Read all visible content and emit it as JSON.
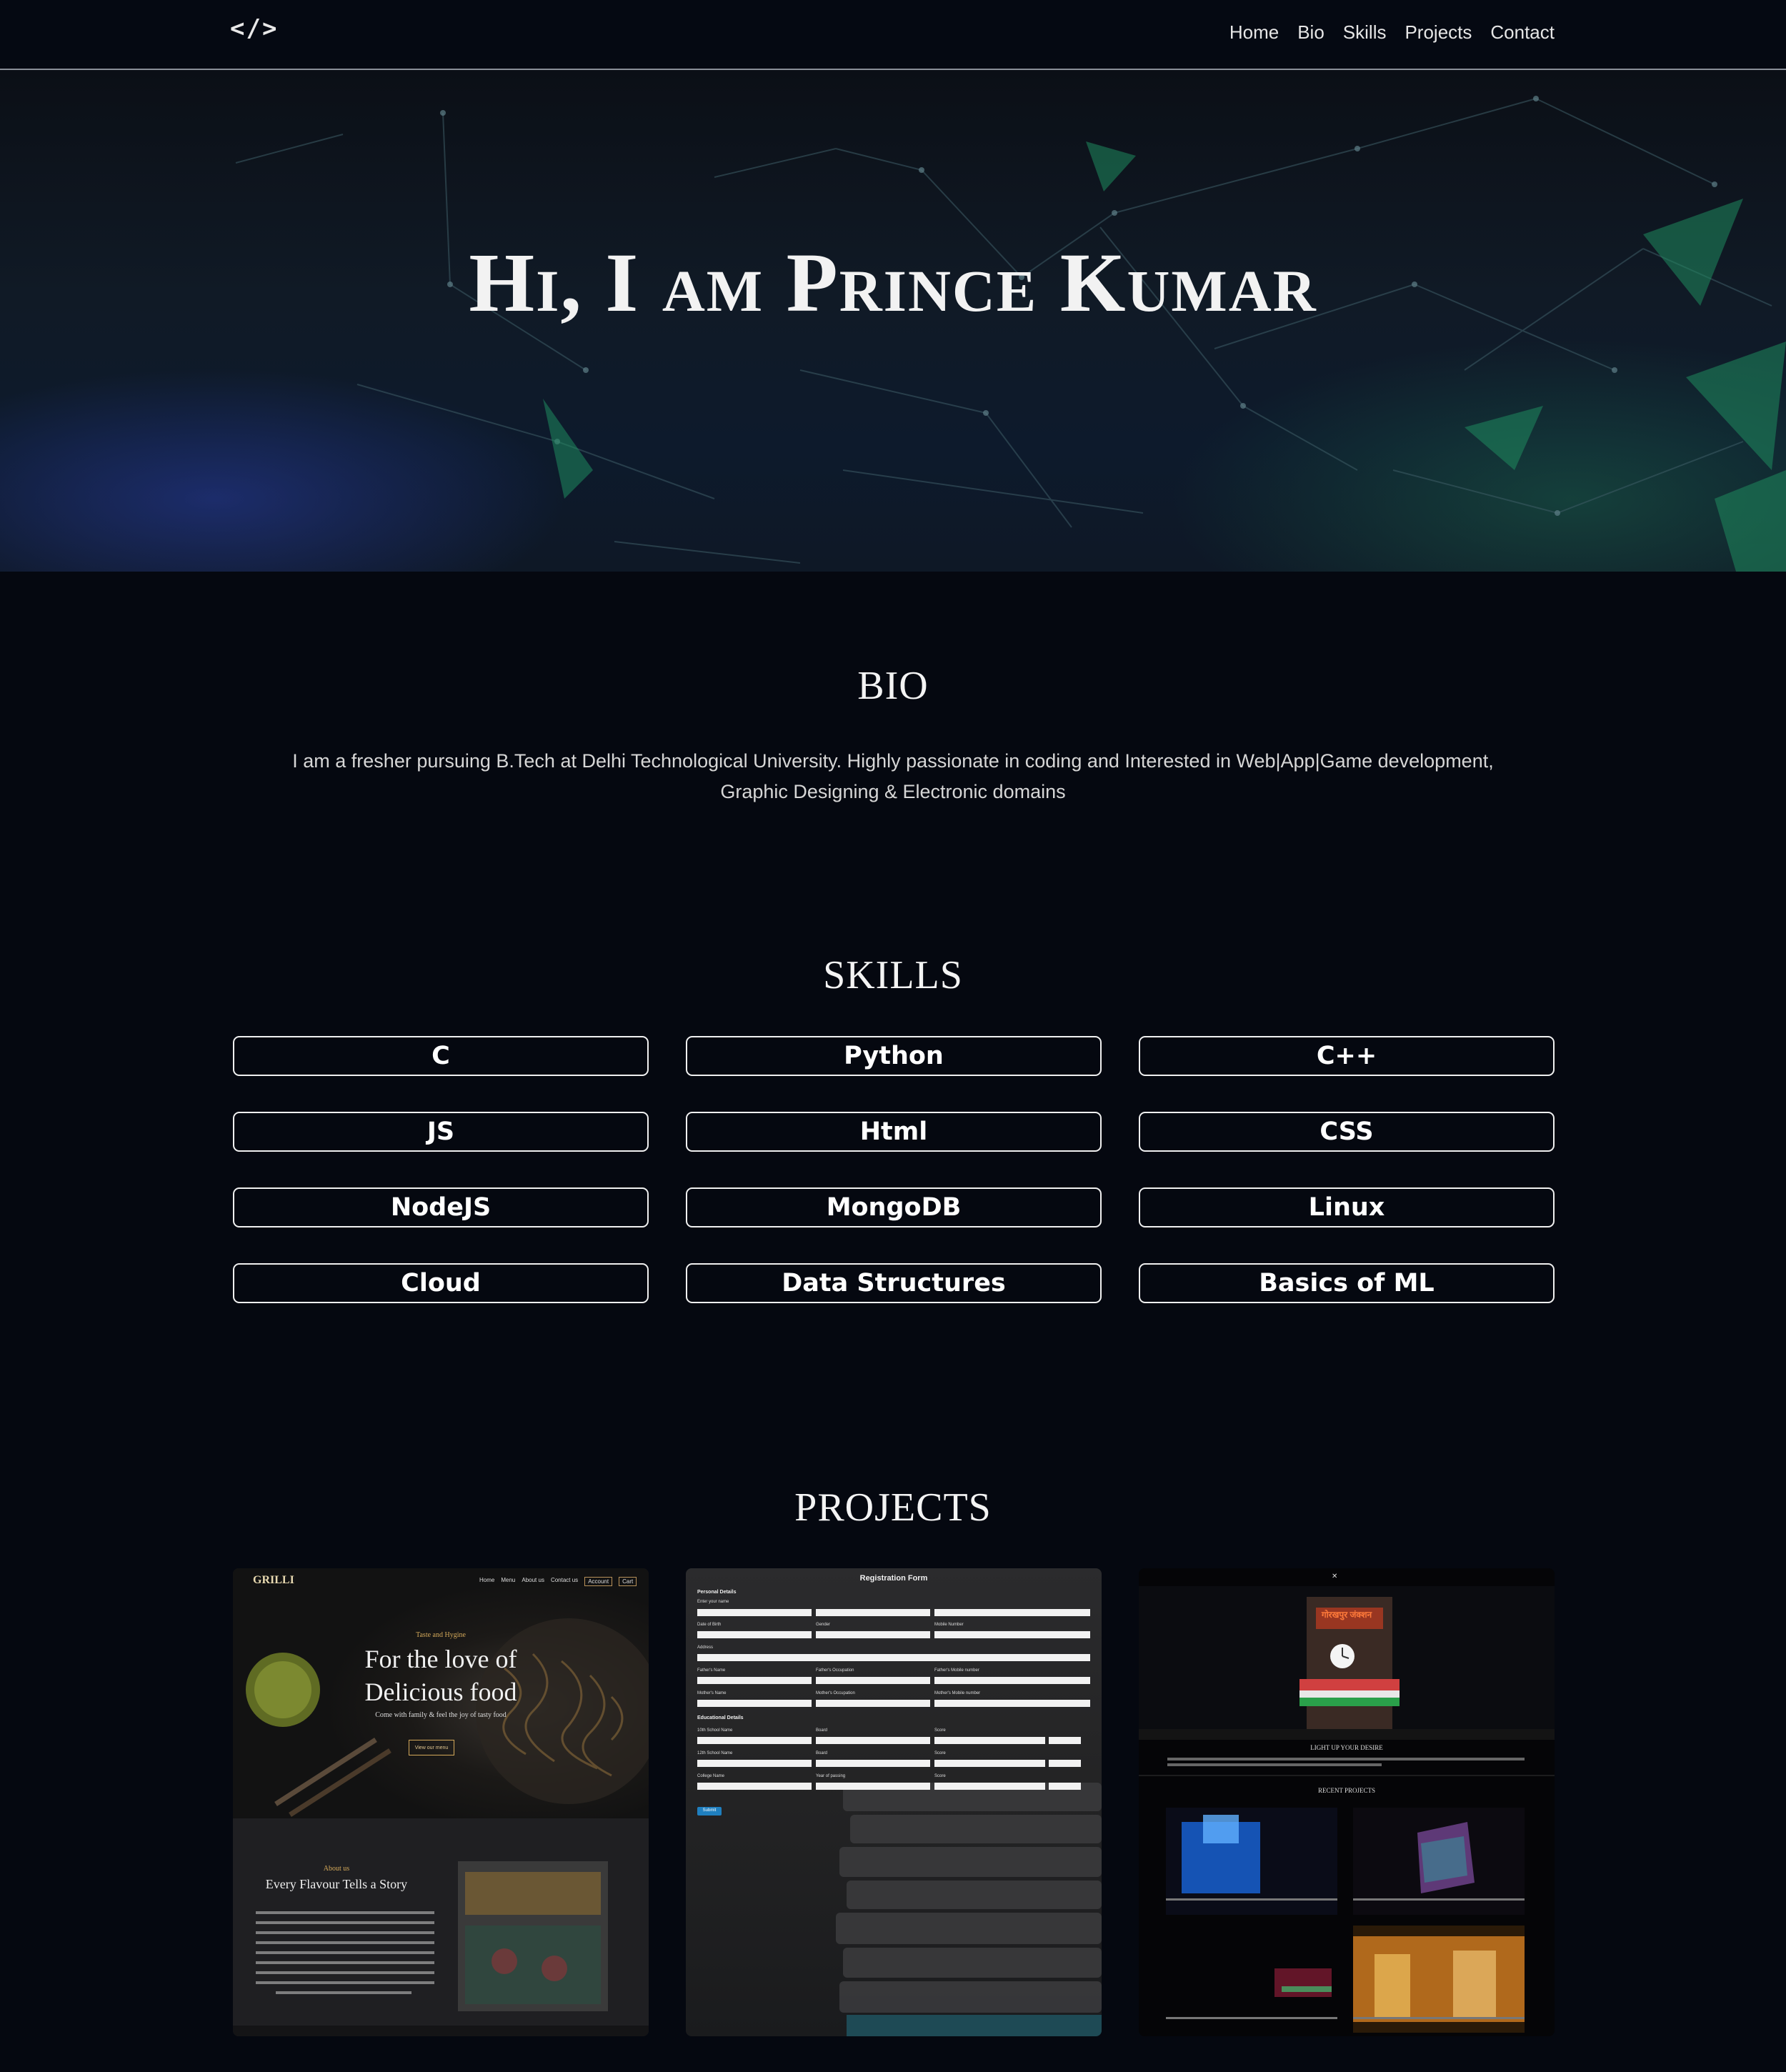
{
  "nav": {
    "logo": "</>",
    "links": [
      "Home",
      "Bio",
      "Skills",
      "Projects",
      "Contact"
    ]
  },
  "hero": {
    "title": "Hi, I am Prince Kumar"
  },
  "bio": {
    "heading": "BIO",
    "line1": "I am a fresher pursuing B.Tech at Delhi Technological University. Highly passionate in coding and Interested in Web|App|Game development,",
    "line2": "Graphic Designing & Electronic domains"
  },
  "skills": {
    "heading": "SKILLS",
    "items": [
      "C",
      "Python",
      "C++",
      "JS",
      "Html",
      "CSS",
      "NodeJS",
      "MongoDB",
      "Linux",
      "Cloud",
      "Data Structures",
      "Basics of ML"
    ]
  },
  "projects": {
    "heading": "PROJECTS",
    "cards": [
      {
        "logo": "GRILLI",
        "nav": [
          "Home",
          "Menu",
          "About us",
          "Contact us",
          "Account",
          "Cart"
        ],
        "kicker": "Taste and Hygine",
        "headline1": "For the love of",
        "headline2": "Delicious food",
        "tagline": "Come with family & feel the joy of tasty food",
        "cta": "View our menu",
        "about_kicker": "About us",
        "about_title": "Every Flavour Tells a Story"
      },
      {
        "title": "Registration Form",
        "section1": "Personal Details",
        "section2": "Educational Details",
        "labels": [
          "Enter your name",
          "Date of Birth",
          "Gender",
          "Mobile Number",
          "Address",
          "Father's Name",
          "Father's Occupation",
          "Father's Mobile number",
          "Mother's Name",
          "Mother's Occupation",
          "Mother's Mobile number",
          "10th School Name",
          "Board",
          "Score",
          "12th School Name",
          "Board",
          "Score",
          "College Name",
          "Year of passing",
          "Score"
        ],
        "submit": "Submit"
      },
      {
        "brand": "गोरखपुर जंक्शन",
        "heading": "LIGHT UP YOUR DESIRE",
        "recent": "RECENT PROJECTS"
      }
    ]
  },
  "colors": {
    "background": "#050810",
    "nav_border": "#8a8f98",
    "hero_green": "#1f8a5e",
    "hero_blue": "#2b3aa0"
  }
}
